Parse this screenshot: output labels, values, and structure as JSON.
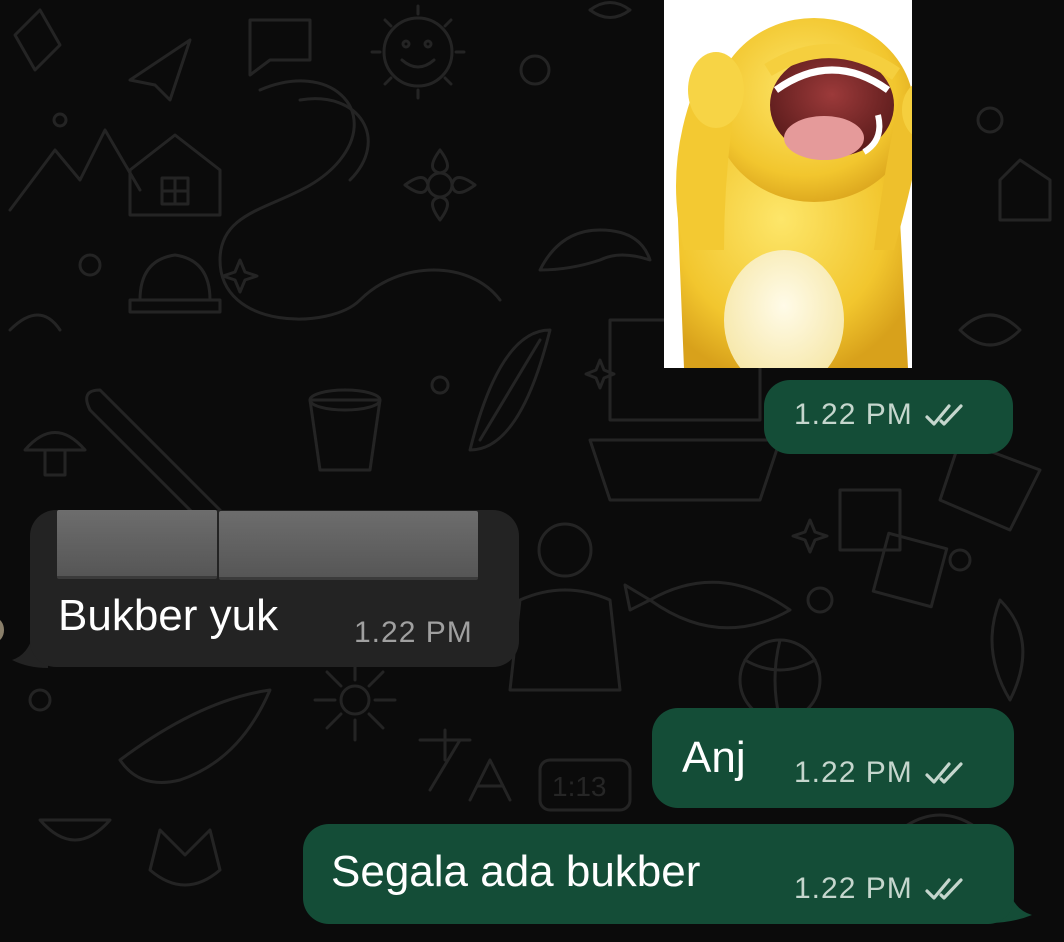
{
  "colors": {
    "background": "#0b0b0b",
    "outgoing_bubble": "#144d37",
    "incoming_bubble": "#232323",
    "sticker_yellow": "#f6d23c"
  },
  "sticker": {
    "description_icon": "yellow-creature-sticker-icon",
    "time": "1.22 PM",
    "status_icon": "double-check-icon"
  },
  "messages": [
    {
      "direction": "incoming",
      "sender_redacted": true,
      "text": "Bukber yuk",
      "time": "1.22 PM"
    },
    {
      "direction": "outgoing",
      "text": "Anj",
      "time": "1.22 PM",
      "status_icon": "double-check-icon"
    },
    {
      "direction": "outgoing",
      "text": "Segala ada bukber",
      "time": "1.22 PM",
      "status_icon": "double-check-icon"
    }
  ]
}
